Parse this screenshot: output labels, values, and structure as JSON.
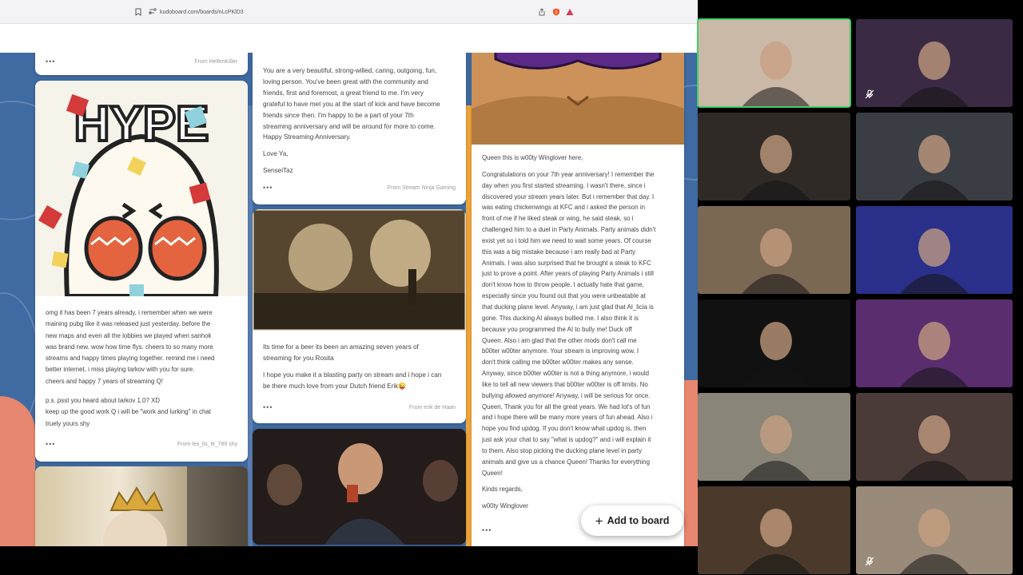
{
  "browser": {
    "url": "kudoboard.com/boards/nLcPKlD3"
  },
  "colors": {
    "board_background": "#3f6aa2",
    "speaking_outline": "#3fcf6a"
  },
  "posts": {
    "top_left_from": "From HellenKiller",
    "hype": {
      "image_text": "HYPE",
      "message_lines": [
        "omg it has been 7 years already, i remember when we were",
        "maining pubg like it was released just yesterday. before the",
        "new maps and even all the lobbies we played when sanhok",
        "was brand new. wow how time flys. cheers to so many more",
        "streams and happy times playing together. remind me i need",
        "better internet, i miss playing tarkov with you for sure.",
        "cheers and happy 7 years of streaming Q!"
      ],
      "ps_lines": [
        "p.s. psst you heard about tarkov 1.0? XD",
        "keep up the good work Q i will be \"work and lurking\" in chat",
        "truely yours shy"
      ],
      "from": "From les_lis_lit_789 shy"
    },
    "taz": {
      "p1_lines": [
        "You are a very beautiful, strong-willed, caring, outgoing, fun,",
        "loving person. You've been great with the community and",
        "friends, first and foremost, a great friend to me. I'm very",
        "grateful to have met you at the start of kick and have become",
        "friends since then.  I'm happy to be a part of your 7th",
        "streaming anniversary and will be around for more to come.",
        "Happy Streaming Anniversary."
      ],
      "p2": "Love Ya,",
      "p3": "SenseiTaz",
      "from": "From Stream Ninja Gaming"
    },
    "beer": {
      "lines1": [
        "Its time for a beer its been an amazing seven years of",
        "streaming for you Rosita"
      ],
      "lines2": [
        "I hope you make it a blasting party on stream and i hope i can",
        "be there much love from your Dutch friend Erik😜"
      ],
      "from": "From erik de Haan"
    },
    "winglover": {
      "greeting": "Queen this is w00ty Winglover here,",
      "body_lines": [
        "Congratulations on your 7th year anniversary! I remember the",
        "day when you first started streaming. I wasn't there, since i",
        "discovered your stream years later. But i remember that day. I",
        "was eating chickenwings at KFC and i asked the person in",
        "front of me if he liked steak or wing, he said steak, so i",
        "challenged him to a duel in Party Animals. Party animals didn't",
        "exist yet so i told him we need to wait some years. Of course",
        "this was a big mistake because i am really bad at Party",
        "Animals. I was also surprised that he brought a steak to KFC",
        "just to prove a point.  After years of playing Party Animals i still",
        "don't know how to throw people. I actually hate that game,",
        "especially since you found out that you were unbeatable at",
        "that ducking plane level. Anyway, i am just glad that AI_licia is",
        "gone. This ducking AI always bullied me. I also think it is",
        "because you programmed the AI to bully me! Duck off",
        "Queen. Also i am glad that the other mods don't call me",
        "b00ter w00ter anymore. Your stream is improving wow. I",
        "don't think calling me b00ter w00ter makes any sense.",
        "Anyway, since b00ter w00ter is not a thing anymore, i would",
        "like to tell all new viewers that b00ter w00ter is off limits. No",
        "bullying allowed anymore! Anyway, i will be serious for once.",
        "Queen, Thank you for all the great years. We had lot's of fun",
        "and i hope there will be many more years of fun ahead. Also i",
        "hope you find updog. If you don't know what updog is, then",
        "just ask your chat to say \"what is updog?\" and i will explain it",
        "to them. Also stop picking the ducking plane level in party",
        "animals and give us a chance Queen! Thanks for everything",
        "Queen!"
      ],
      "closing": "Kinds regards,",
      "signature": "w00ty Winglover"
    },
    "more_dots": "•••"
  },
  "actions": {
    "add_to_board": "Add to board"
  },
  "video_grid": {
    "tiles": [
      {
        "name": "participant-1",
        "bg": "#c9b9a6",
        "speaking": true,
        "muted": false
      },
      {
        "name": "participant-2",
        "bg": "#3a2a44",
        "speaking": false,
        "muted": true
      },
      {
        "name": "participant-3",
        "bg": "#2f2a26",
        "speaking": false,
        "muted": false
      },
      {
        "name": "participant-4",
        "bg": "#3b3d44",
        "speaking": false,
        "muted": false
      },
      {
        "name": "participant-5",
        "bg": "#7b6853",
        "speaking": false,
        "muted": false
      },
      {
        "name": "participant-6",
        "bg": "#2a2f8a",
        "speaking": false,
        "muted": false
      },
      {
        "name": "participant-7",
        "bg": "#111111",
        "speaking": false,
        "muted": false
      },
      {
        "name": "participant-8",
        "bg": "#5a2d6e",
        "speaking": false,
        "muted": false
      },
      {
        "name": "participant-9",
        "bg": "#8a8579",
        "speaking": false,
        "muted": false
      },
      {
        "name": "participant-10",
        "bg": "#4a3a38",
        "speaking": false,
        "muted": false
      },
      {
        "name": "participant-11",
        "bg": "#4b3a2c",
        "speaking": false,
        "muted": false
      },
      {
        "name": "participant-12",
        "bg": "#9a8a7a",
        "speaking": false,
        "muted": true
      }
    ]
  }
}
